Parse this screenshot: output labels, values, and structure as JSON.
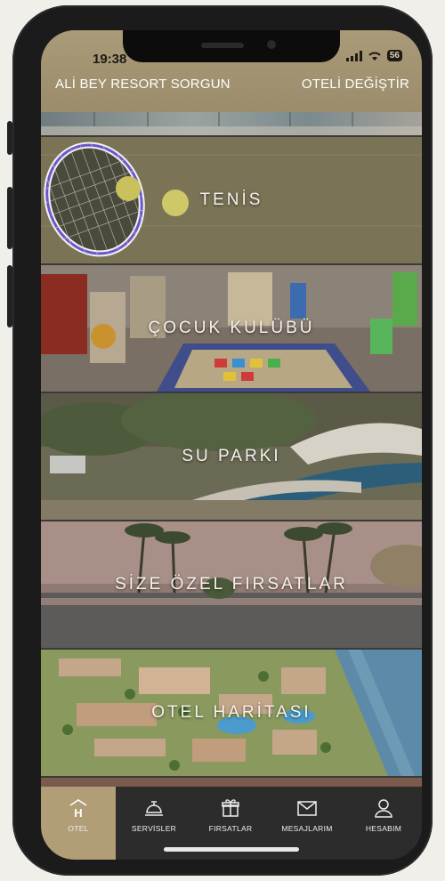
{
  "status_bar": {
    "time": "19:38",
    "battery": "56"
  },
  "header": {
    "hotel_name": "ALİ BEY RESORT SORGUN",
    "change_hotel": "OTELİ DEĞİŞTİR"
  },
  "cards": [
    {
      "label": "TENİS"
    },
    {
      "label": "ÇOCUK KULÜBÜ"
    },
    {
      "label": "SU PARKI"
    },
    {
      "label": "SİZE ÖZEL FIRSATLAR"
    },
    {
      "label": "OTEL HARİTASI"
    }
  ],
  "tabs": [
    {
      "label": "OTEL",
      "icon": "hotel-icon",
      "active": true
    },
    {
      "label": "SERVİSLER",
      "icon": "concierge-bell-icon"
    },
    {
      "label": "FIRSATLAR",
      "icon": "gift-icon"
    },
    {
      "label": "MESAJLARIM",
      "icon": "mail-icon"
    },
    {
      "label": "HESABIM",
      "icon": "user-icon"
    }
  ],
  "colors": {
    "header": "#a99a78",
    "active_tab": "#b19e77",
    "tab_bar": "#2c2c2c"
  }
}
